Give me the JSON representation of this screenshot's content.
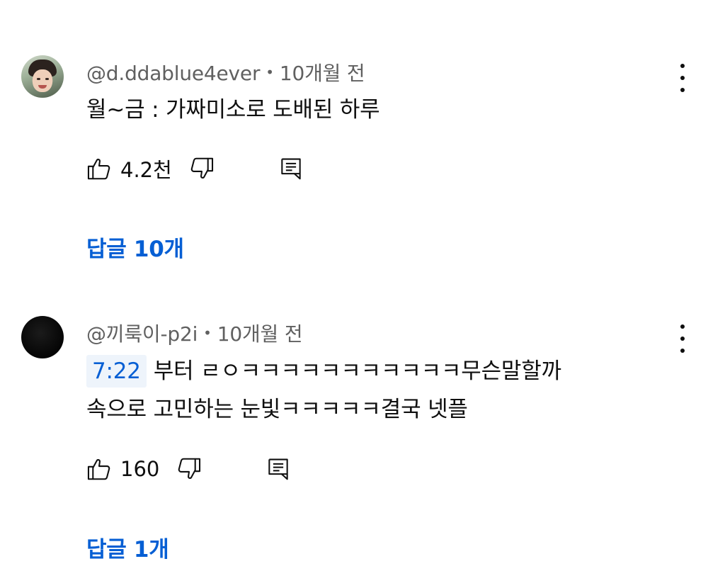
{
  "comments": [
    {
      "author": "@d.ddablue4ever",
      "separator": "•",
      "time": "10개월 전",
      "text_lines": [
        "월~금 : 가짜미소로 도배된 하루"
      ],
      "timestamp_link": "",
      "likes": "4.2천",
      "replies": "답글 10개",
      "avatar": "profile-photo"
    },
    {
      "author": "@끼룩이-p2i",
      "separator": "•",
      "time": "10개월 전",
      "timestamp_link": "7:22",
      "text_lines": [
        "부터 ㄹㅇㅋㅋㅋㅋㅋㅋㅋㅋㅋㅋㅋ무슨말할까",
        "속으로 고민하는 눈빛ㅋㅋㅋㅋㅋ결국 넷플"
      ],
      "likes": "160",
      "replies": "답글 1개",
      "avatar": "black-circle"
    }
  ],
  "icons": {
    "like": "thumbs-up-icon",
    "dislike": "thumbs-down-icon",
    "reply": "reply-comment-icon",
    "menu": "more-vertical-icon"
  },
  "colors": {
    "link_blue": "#065fd4",
    "meta_gray": "#606060",
    "text": "#0f0f0f"
  }
}
